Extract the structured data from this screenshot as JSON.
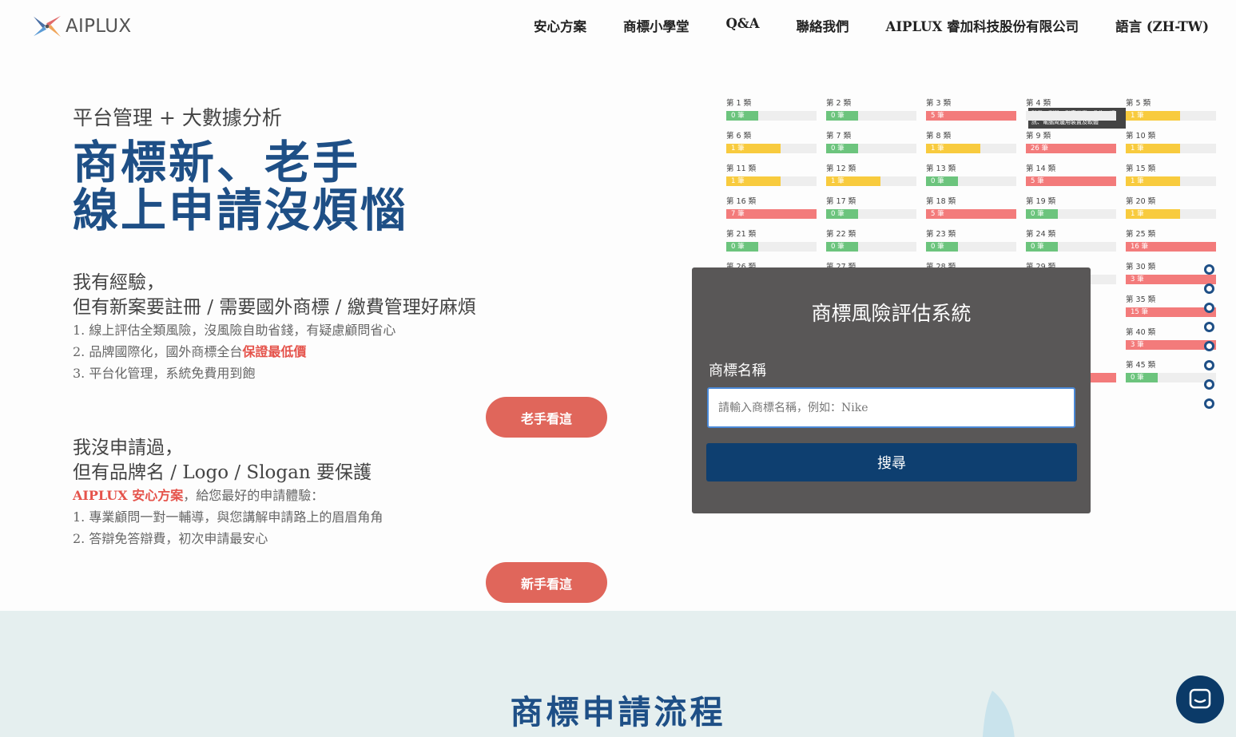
{
  "brand": {
    "name": "AIPLUX"
  },
  "nav": [
    {
      "label": "安心方案"
    },
    {
      "label": "商標小學堂"
    },
    {
      "label": "Q&A"
    },
    {
      "label": "聯絡我們"
    },
    {
      "label": "AIPLUX 睿加科技股份有限公司"
    },
    {
      "label": "語言 (ZH-TW)"
    }
  ],
  "hero": {
    "subtitle": "平台管理 + 大數據分析",
    "title_line1": "商標新、老手",
    "title_line2": "線上申請沒煩惱"
  },
  "veteran": {
    "head_line1": "我有經驗，",
    "head_line2": "但有新案要註冊 / 需要國外商標 / 繳費管理好麻煩",
    "item1": "1. 線上評估全類風險，沒風險自助省錢，有疑慮顧問省心",
    "item2_prefix": "2. 品牌國際化，國外商標全台",
    "item2_highlight": "保證最低價",
    "item3": "3. 平台化管理，系統免費用到飽",
    "button": "老手看這"
  },
  "newbie": {
    "head_line1": "我沒申請過，",
    "head_line2": "但有品牌名 / Logo / Slogan 要保護",
    "intro_highlight": "AIPLUX 安心方案",
    "intro_rest": "，給您最好的申請體驗：",
    "item1": "1. 專業顧問一對一輔導，與您講解申請路上的眉眉角角",
    "item2": "2. 答辯免答辯費，初次申請最安心",
    "button": "新手看這"
  },
  "risk_grid": {
    "tooltip": "科學、測量、影音光學、救生、通訊、電腦周邊用裝置及軟體",
    "colors": {
      "green": "#6cc47d",
      "yellow": "#f8cb3e",
      "red": "#f37b7b"
    },
    "cells": [
      {
        "label": "第 1 類",
        "count": "0 筆",
        "level": "green",
        "fill": 0.35
      },
      {
        "label": "第 2 類",
        "count": "0 筆",
        "level": "green",
        "fill": 0.35
      },
      {
        "label": "第 3 類",
        "count": "5 筆",
        "level": "red",
        "fill": 1.0
      },
      {
        "label": "第 4 類",
        "count": "",
        "level": "none",
        "fill": 0
      },
      {
        "label": "第 5 類",
        "count": "1 筆",
        "level": "yellow",
        "fill": 0.6
      },
      {
        "label": "第 6 類",
        "count": "1 筆",
        "level": "yellow",
        "fill": 0.6
      },
      {
        "label": "第 7 類",
        "count": "0 筆",
        "level": "green",
        "fill": 0.35
      },
      {
        "label": "第 8 類",
        "count": "1 筆",
        "level": "yellow",
        "fill": 0.6
      },
      {
        "label": "第 9 類",
        "count": "26 筆",
        "level": "red",
        "fill": 1.0
      },
      {
        "label": "第 10 類",
        "count": "1 筆",
        "level": "yellow",
        "fill": 0.6
      },
      {
        "label": "第 11 類",
        "count": "1 筆",
        "level": "yellow",
        "fill": 0.6
      },
      {
        "label": "第 12 類",
        "count": "1 筆",
        "level": "yellow",
        "fill": 0.6
      },
      {
        "label": "第 13 類",
        "count": "0 筆",
        "level": "green",
        "fill": 0.35
      },
      {
        "label": "第 14 類",
        "count": "5 筆",
        "level": "red",
        "fill": 1.0
      },
      {
        "label": "第 15 類",
        "count": "1 筆",
        "level": "yellow",
        "fill": 0.6
      },
      {
        "label": "第 16 類",
        "count": "7 筆",
        "level": "red",
        "fill": 1.0
      },
      {
        "label": "第 17 類",
        "count": "0 筆",
        "level": "green",
        "fill": 0.35
      },
      {
        "label": "第 18 類",
        "count": "5 筆",
        "level": "red",
        "fill": 1.0
      },
      {
        "label": "第 19 類",
        "count": "0 筆",
        "level": "green",
        "fill": 0.35
      },
      {
        "label": "第 20 類",
        "count": "1 筆",
        "level": "yellow",
        "fill": 0.6
      },
      {
        "label": "第 21 類",
        "count": "0 筆",
        "level": "green",
        "fill": 0.35
      },
      {
        "label": "第 22 類",
        "count": "0 筆",
        "level": "green",
        "fill": 0.35
      },
      {
        "label": "第 23 類",
        "count": "0 筆",
        "level": "green",
        "fill": 0.35
      },
      {
        "label": "第 24 類",
        "count": "0 筆",
        "level": "green",
        "fill": 0.35
      },
      {
        "label": "第 25 類",
        "count": "16 筆",
        "level": "red",
        "fill": 1.0
      },
      {
        "label": "第 26 類",
        "count": "",
        "level": "none",
        "fill": 0
      },
      {
        "label": "第 27 類",
        "count": "",
        "level": "none",
        "fill": 0
      },
      {
        "label": "第 28 類",
        "count": "",
        "level": "none",
        "fill": 0
      },
      {
        "label": "第 29 類",
        "count": "",
        "level": "none",
        "fill": 0
      },
      {
        "label": "第 30 類",
        "count": "3 筆",
        "level": "red",
        "fill": 1.0
      },
      {
        "label": "",
        "count": "",
        "level": "none",
        "fill": 0
      },
      {
        "label": "",
        "count": "",
        "level": "none",
        "fill": 0
      },
      {
        "label": "",
        "count": "",
        "level": "none",
        "fill": 0
      },
      {
        "label": "",
        "count": "",
        "level": "none",
        "fill": 0
      },
      {
        "label": "第 35 類",
        "count": "15 筆",
        "level": "red",
        "fill": 1.0
      },
      {
        "label": "",
        "count": "",
        "level": "none",
        "fill": 0
      },
      {
        "label": "",
        "count": "",
        "level": "none",
        "fill": 0
      },
      {
        "label": "",
        "count": "",
        "level": "none",
        "fill": 0
      },
      {
        "label": "",
        "count": "",
        "level": "none",
        "fill": 0
      },
      {
        "label": "第 40 類",
        "count": "3 筆",
        "level": "red",
        "fill": 1.0
      },
      {
        "label": "",
        "count": "",
        "level": "none",
        "fill": 0
      },
      {
        "label": "",
        "count": "",
        "level": "none",
        "fill": 0
      },
      {
        "label": "",
        "count": "",
        "level": "none",
        "fill": 0
      },
      {
        "label": "",
        "count": "",
        "level": "red",
        "fill": 1.0
      },
      {
        "label": "第 45 類",
        "count": "0 筆",
        "level": "green",
        "fill": 0.35
      }
    ]
  },
  "search_card": {
    "title": "商標風險評估系統",
    "label": "商標名稱",
    "placeholder": "請輸入商標名稱，例如：Nike",
    "value": "",
    "button": "搜尋"
  },
  "process": {
    "title": "商標申請流程"
  },
  "colors": {
    "accent": "#1e4f86",
    "cta": "#e0665b",
    "card_bg": "#595757",
    "search_btn": "#0e3f70",
    "section_bg": "#e5efef"
  }
}
